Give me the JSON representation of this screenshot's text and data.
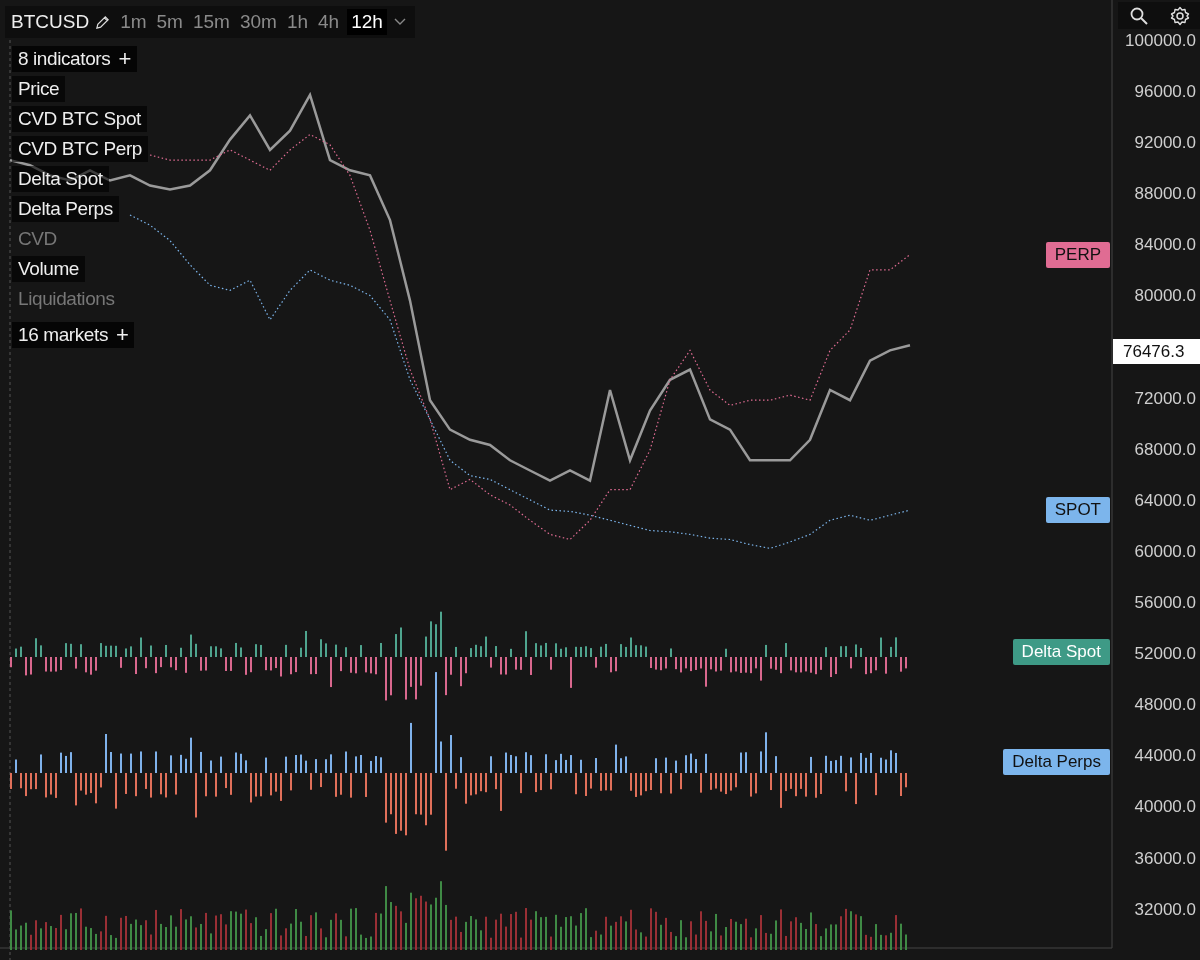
{
  "toolbar": {
    "symbol": "BTCUSD",
    "timeframes": [
      {
        "label": "1m",
        "selected": false
      },
      {
        "label": "5m",
        "selected": false
      },
      {
        "label": "15m",
        "selected": false
      },
      {
        "label": "30m",
        "selected": false
      },
      {
        "label": "1h",
        "selected": false
      },
      {
        "label": "4h",
        "selected": false
      },
      {
        "label": "12h",
        "selected": true
      }
    ]
  },
  "indicators_button": {
    "label": "8 indicators",
    "plus": "+"
  },
  "indicators": [
    {
      "label": "Price",
      "visible": true
    },
    {
      "label": "CVD BTC Spot",
      "visible": true
    },
    {
      "label": "CVD BTC Perp",
      "visible": true
    },
    {
      "label": "Delta Spot",
      "visible": true
    },
    {
      "label": "Delta Perps",
      "visible": true
    },
    {
      "label": "CVD",
      "visible": false
    },
    {
      "label": "Volume",
      "visible": true
    },
    {
      "label": "Liquidations",
      "visible": false
    }
  ],
  "markets_button": {
    "label": "16 markets",
    "plus": "+"
  },
  "chart": {
    "current_price": "76476.3",
    "tags": [
      {
        "label": "Delta Spot",
        "color": "#3e9a86"
      },
      {
        "label": "Delta Perps",
        "color": "#7cb5ec"
      }
    ],
    "chart_data": {
      "type": "line",
      "ylim": [
        29000,
        100000
      ],
      "yticks": [
        {
          "value": 100000,
          "label": "100000.0"
        },
        {
          "value": 96000,
          "label": "96000.0"
        },
        {
          "value": 92000,
          "label": "92000.0"
        },
        {
          "value": 88000,
          "label": "88000.0"
        },
        {
          "value": 84000,
          "label": "84000.0"
        },
        {
          "value": 80000,
          "label": "80000.0"
        },
        {
          "value": 72000,
          "label": "72000.0"
        },
        {
          "value": 68000,
          "label": "68000.0"
        },
        {
          "value": 64000,
          "label": "64000.0"
        },
        {
          "value": 60000,
          "label": "60000.0"
        },
        {
          "value": 56000,
          "label": "56000.0"
        },
        {
          "value": 52000,
          "label": "52000.0"
        },
        {
          "value": 48000,
          "label": "48000.0"
        },
        {
          "value": 44000,
          "label": "44000.0"
        },
        {
          "value": 40000,
          "label": "40000.0"
        },
        {
          "value": 36000,
          "label": "36000.0"
        },
        {
          "value": 32000,
          "label": "32000.0"
        }
      ],
      "series": [
        {
          "color": "#9a9a9a",
          "line_style": "solid",
          "values": [
            90600,
            90200,
            89400,
            89000,
            89800,
            89000,
            89400,
            88600,
            88300,
            88600,
            89800,
            92200,
            94100,
            91400,
            92900,
            95700,
            90600,
            89800,
            89400,
            85900,
            79600,
            71800,
            69500,
            68700,
            68300,
            67100,
            66300,
            65500,
            66300,
            65500,
            72600,
            67100,
            71000,
            73400,
            74200,
            70300,
            69500,
            67100,
            67100,
            67100,
            68700,
            72600,
            71800,
            74900,
            75700,
            76100
          ]
        },
        {
          "name": "PERP",
          "color": "#e06c93",
          "line_style": "dotted",
          "values": [
            null,
            null,
            null,
            null,
            null,
            null,
            null,
            91000,
            90600,
            90600,
            90600,
            91400,
            90600,
            89800,
            91400,
            92600,
            91800,
            89400,
            85100,
            79600,
            74200,
            70300,
            64800,
            65600,
            64400,
            63600,
            62400,
            61300,
            60900,
            62400,
            64800,
            64800,
            67900,
            73400,
            75700,
            72600,
            71400,
            71800,
            71800,
            72200,
            71800,
            75700,
            77300,
            82000,
            82000,
            83200
          ]
        },
        {
          "name": "SPOT",
          "color": "#7cb5ec",
          "line_style": "dotted",
          "values": [
            null,
            null,
            null,
            null,
            null,
            null,
            86300,
            85500,
            84300,
            82400,
            80800,
            80400,
            81200,
            78100,
            80400,
            82000,
            81200,
            80800,
            80000,
            78100,
            73400,
            70300,
            67100,
            65900,
            65600,
            64800,
            64000,
            63200,
            63100,
            62800,
            62400,
            62000,
            61600,
            61500,
            61300,
            61000,
            60900,
            60500,
            60200,
            60700,
            61300,
            62400,
            62800,
            62400,
            62800,
            63200
          ]
        }
      ]
    }
  }
}
